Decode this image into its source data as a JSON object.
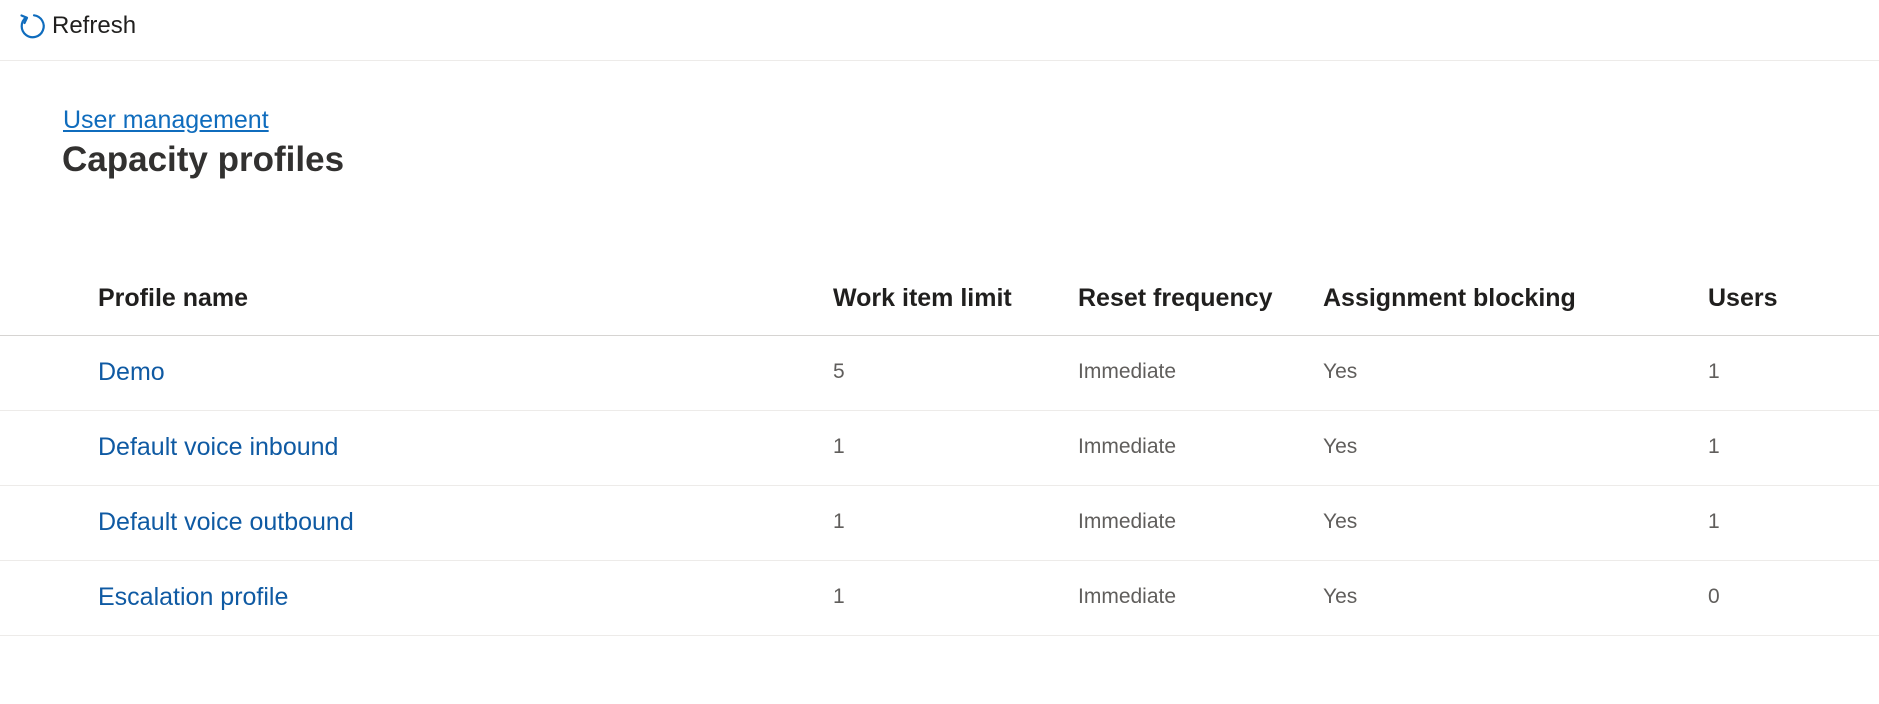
{
  "toolbar": {
    "refresh_label": "Refresh",
    "refresh_icon": "refresh-icon"
  },
  "breadcrumb": {
    "parent_label": "User management"
  },
  "page": {
    "title": "Capacity profiles"
  },
  "colors": {
    "link": "#0f6cbd",
    "row_link": "#0f5aa3",
    "title": "#323130",
    "cell_text": "#605e5c",
    "border": "#edebe9"
  },
  "table": {
    "columns": [
      "Profile name",
      "Work item limit",
      "Reset frequency",
      "Assignment blocking",
      "Users"
    ],
    "rows": [
      {
        "name": "Demo",
        "work_item_limit": "5",
        "reset_frequency": "Immediate",
        "assignment_blocking": "Yes",
        "users": "1"
      },
      {
        "name": "Default voice inbound",
        "work_item_limit": "1",
        "reset_frequency": "Immediate",
        "assignment_blocking": "Yes",
        "users": "1"
      },
      {
        "name": "Default voice outbound",
        "work_item_limit": "1",
        "reset_frequency": "Immediate",
        "assignment_blocking": "Yes",
        "users": "1"
      },
      {
        "name": "Escalation profile",
        "work_item_limit": "1",
        "reset_frequency": "Immediate",
        "assignment_blocking": "Yes",
        "users": "0"
      }
    ]
  }
}
